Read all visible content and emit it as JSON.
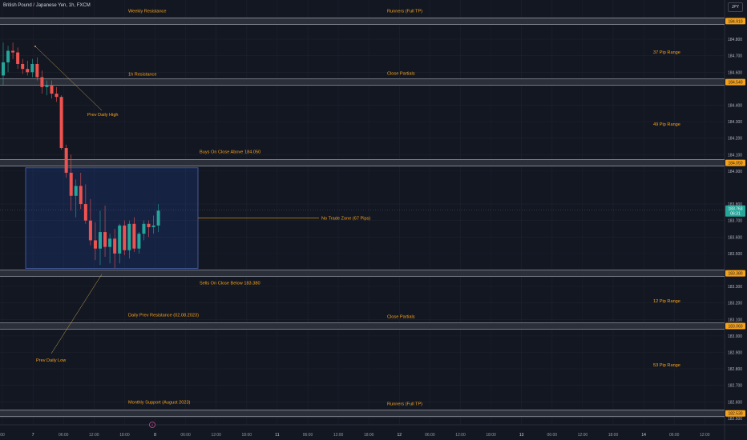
{
  "header": {
    "title": "British Pound / Japanese Yen, 1h, FXCM",
    "currency": "JPY"
  },
  "colors": {
    "background": "#131722",
    "grid": "#1e222d",
    "up": "#26a69a",
    "down": "#ef5350",
    "annotation": "#f7a21b",
    "zone_line": "#8b8f99",
    "box_border": "#2962ff"
  },
  "price_axis": {
    "min": 182.48,
    "max": 184.98,
    "ticks": [
      "184.800",
      "184.700",
      "184.600",
      "184.400",
      "184.300",
      "184.200",
      "184.100",
      "184.000",
      "183.800",
      "183.700",
      "183.600",
      "183.500",
      "183.300",
      "183.200",
      "183.100",
      "183.000",
      "182.900",
      "182.800",
      "182.700",
      "182.600",
      "182.500"
    ],
    "current_price": "183.763",
    "countdown": "06:31"
  },
  "time_axis": {
    "labels": [
      "00",
      "7",
      "06:00",
      "12:00",
      "18:00",
      "8",
      "06:00",
      "12:00",
      "18:00",
      "11",
      "06:00",
      "12:00",
      "18:00",
      "12",
      "06:00",
      "12:00",
      "18:00",
      "13",
      "06:00",
      "12:00",
      "18:00",
      "14",
      "06:00",
      "12:00"
    ]
  },
  "zones": [
    {
      "price": 184.91,
      "price_label": "184.910",
      "left_label": "Weekly Resistance",
      "right_label": "Runners (Full TP)"
    },
    {
      "price": 184.54,
      "price_label": "184.540",
      "left_label": "1h Resistance",
      "right_label": "Close Partials"
    },
    {
      "price": 184.05,
      "price_label": "184.050",
      "left_label": "Buys On Close Above 184.050",
      "right_label": ""
    },
    {
      "price": 183.38,
      "price_label": "183.380",
      "left_label": "Sells On Close Below 183.380",
      "right_label": ""
    },
    {
      "price": 183.06,
      "price_label": "183.060",
      "left_label": "Daily Prev Resistance (02.08.2023)",
      "right_label": "Close Partials"
    },
    {
      "price": 182.53,
      "price_label": "182.530",
      "left_label": "Monthly Support (August 2023)",
      "right_label": "Runners (Full TP)"
    }
  ],
  "range_labels": [
    "37 Pip Range",
    "49 Pip Range",
    "12 Pip Range",
    "53 Pip Range"
  ],
  "no_trade_zone": {
    "label": "No Trade Zone (67 Pips)",
    "top": 184.02,
    "bottom": 183.41
  },
  "annotations": {
    "prev_daily_high": "Prev Daily High",
    "prev_daily_low": "Prev Daily Low"
  },
  "candles": [
    {
      "o": 184.58,
      "h": 184.78,
      "l": 184.52,
      "c": 184.66
    },
    {
      "o": 184.66,
      "h": 184.76,
      "l": 184.6,
      "c": 184.73
    },
    {
      "o": 184.73,
      "h": 184.78,
      "l": 184.68,
      "c": 184.72
    },
    {
      "o": 184.72,
      "h": 184.75,
      "l": 184.62,
      "c": 184.65
    },
    {
      "o": 184.65,
      "h": 184.68,
      "l": 184.59,
      "c": 184.62
    },
    {
      "o": 184.62,
      "h": 184.67,
      "l": 184.58,
      "c": 184.6
    },
    {
      "o": 184.6,
      "h": 184.68,
      "l": 184.57,
      "c": 184.65
    },
    {
      "o": 184.65,
      "h": 184.69,
      "l": 184.55,
      "c": 184.57
    },
    {
      "o": 184.57,
      "h": 184.61,
      "l": 184.47,
      "c": 184.51
    },
    {
      "o": 184.51,
      "h": 184.55,
      "l": 184.46,
      "c": 184.52
    },
    {
      "o": 184.52,
      "h": 184.55,
      "l": 184.44,
      "c": 184.47
    },
    {
      "o": 184.47,
      "h": 184.51,
      "l": 184.42,
      "c": 184.45
    },
    {
      "o": 184.45,
      "h": 184.46,
      "l": 184.13,
      "c": 184.14
    },
    {
      "o": 184.14,
      "h": 184.16,
      "l": 183.96,
      "c": 183.99
    },
    {
      "o": 183.99,
      "h": 184.1,
      "l": 183.76,
      "c": 183.85
    },
    {
      "o": 183.85,
      "h": 183.95,
      "l": 183.72,
      "c": 183.91
    },
    {
      "o": 183.91,
      "h": 183.99,
      "l": 183.77,
      "c": 183.8
    },
    {
      "o": 183.8,
      "h": 183.92,
      "l": 183.68,
      "c": 183.7
    },
    {
      "o": 183.7,
      "h": 183.83,
      "l": 183.55,
      "c": 183.58
    },
    {
      "o": 183.58,
      "h": 183.69,
      "l": 183.46,
      "c": 183.53
    },
    {
      "o": 183.53,
      "h": 183.76,
      "l": 183.43,
      "c": 183.63
    },
    {
      "o": 183.63,
      "h": 183.79,
      "l": 183.48,
      "c": 183.54
    },
    {
      "o": 183.54,
      "h": 183.62,
      "l": 183.44,
      "c": 183.59
    },
    {
      "o": 183.59,
      "h": 183.65,
      "l": 183.41,
      "c": 183.5
    },
    {
      "o": 183.5,
      "h": 183.68,
      "l": 183.44,
      "c": 183.67
    },
    {
      "o": 183.67,
      "h": 183.7,
      "l": 183.49,
      "c": 183.52
    },
    {
      "o": 183.52,
      "h": 183.7,
      "l": 183.47,
      "c": 183.68
    },
    {
      "o": 183.68,
      "h": 183.72,
      "l": 183.51,
      "c": 183.53
    },
    {
      "o": 183.53,
      "h": 183.63,
      "l": 183.5,
      "c": 183.62
    },
    {
      "o": 183.62,
      "h": 183.7,
      "l": 183.58,
      "c": 183.68
    },
    {
      "o": 183.68,
      "h": 183.7,
      "l": 183.6,
      "c": 183.66
    },
    {
      "o": 183.66,
      "h": 183.73,
      "l": 183.62,
      "c": 183.67
    },
    {
      "o": 183.67,
      "h": 183.8,
      "l": 183.63,
      "c": 183.76
    }
  ]
}
